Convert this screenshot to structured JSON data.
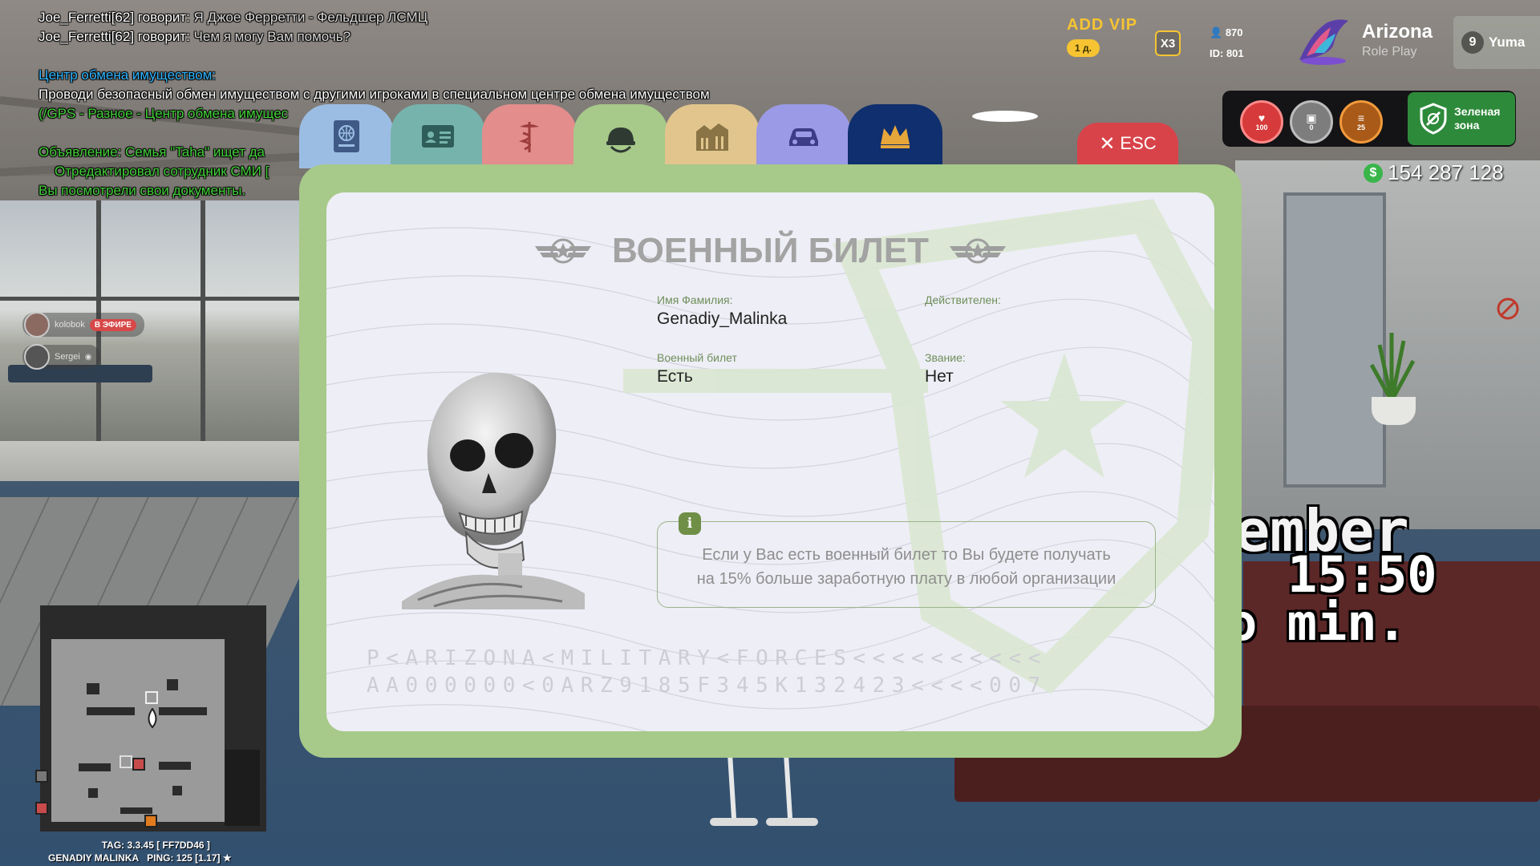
{
  "chat": {
    "lines": [
      {
        "name": "Joe_Ferretti[62] говорит:",
        "text": " Я Джое Ферретти - Фельдшер ЛСМЦ"
      },
      {
        "name": "Joe_Ferretti[62] говорит:",
        "text": " Чем я могу Вам помочь?"
      }
    ],
    "exchange_title": "Центр обмена имуществом:",
    "exchange_text": "Проводи безопасный обмен имуществом с другими игроками в специальном центре обмена имуществом",
    "exchange_gps": "(/GPS - Разное - Центр обмена имущес",
    "ad_line": "Объявление: Семья \"Taha\" ищет да",
    "ad_editor": "Отредактировал сотрудник СМИ [",
    "docs_line": "Вы посмотрели свои документы."
  },
  "streams": [
    {
      "name": "kolobok",
      "badge": "В ЭФИРЕ"
    },
    {
      "name": "Sergei",
      "badge": "◉"
    }
  ],
  "hud": {
    "vip_title": "ADD VIP",
    "vip_days": "1 д.",
    "multiplier": "X3",
    "online_count": "870",
    "player_id": "ID: 801",
    "server_name": "Arizona",
    "server_sub": "Role Play",
    "server_number": "9",
    "server_city": "Yuma",
    "health": "100",
    "armor": "0",
    "hunger": "25",
    "zone_line1": "Зеленая",
    "zone_line2": "зона",
    "money_symbol": "$",
    "money": "154 287 128"
  },
  "overlay": {
    "month_tail": "ember",
    "time": "15:50",
    "minutes": "o min."
  },
  "minimap_info": {
    "tag": "TAG: 3.3.45 [ FF7DD46 ]",
    "player": "GENADIY MALINKA",
    "ping": "PING: 125 [1.17] ★"
  },
  "tabs": [
    {
      "id": "passport",
      "icon": "passport-icon",
      "color": "#9cbde3"
    },
    {
      "id": "id-card",
      "icon": "id-card-icon",
      "color": "#77b3ad"
    },
    {
      "id": "medical",
      "icon": "caduceus-icon",
      "color": "#e38d8d"
    },
    {
      "id": "military",
      "icon": "helmet-icon",
      "color": "#a7c98a"
    },
    {
      "id": "property",
      "icon": "buildings-icon",
      "color": "#e1c58d"
    },
    {
      "id": "vehicles",
      "icon": "car-icon",
      "color": "#9b9ae6"
    },
    {
      "id": "vip",
      "icon": "crown-icon",
      "color": "#0f2f6e"
    }
  ],
  "esc_label": "ESC",
  "document": {
    "title": "ВОЕННЫЙ БИЛЕТ",
    "name_label": "Имя Фамилия:",
    "name_value": "Genadiy_Malinka",
    "valid_label": "Действителен:",
    "valid_value": "",
    "ticket_label": "Военный билет",
    "ticket_value": "Есть",
    "rank_label": "Звание:",
    "rank_value": "Нет",
    "info_line1": "Если у Вас есть военный билет то Вы будете получать",
    "info_line2": "на 15% больше заработную плату в любой организации",
    "mrz_line1": "P<ARIZONA<MILITARY<FORCES<<<<<<<<<<",
    "mrz_line2": "AA000000<0ARZ9185F345K132423<<<<007"
  },
  "colors": {
    "frame": "#a7c98a",
    "card": "#eeeef6",
    "esc": "#d8434a",
    "vip": "#f6c432",
    "zone": "#2e8a3b"
  }
}
